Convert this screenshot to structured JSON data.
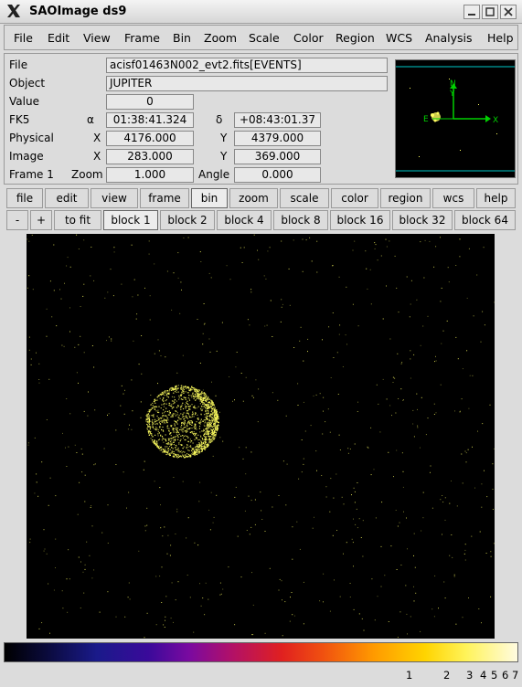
{
  "window": {
    "title": "SAOImage ds9"
  },
  "menu": [
    "File",
    "Edit",
    "View",
    "Frame",
    "Bin",
    "Zoom",
    "Scale",
    "Color",
    "Region",
    "WCS",
    "Analysis",
    "Help"
  ],
  "info": {
    "file_label": "File",
    "file_value": "acisf01463N002_evt2.fits[EVENTS]",
    "object_label": "Object",
    "object_value": "JUPITER",
    "value_label": "Value",
    "value_value": "0",
    "fk5_label": "FK5",
    "alpha_symbol": "α",
    "alpha_value": "01:38:41.324",
    "delta_symbol": "δ",
    "delta_value": "+08:43:01.37",
    "physical_label": "Physical",
    "phys_x_label": "X",
    "phys_x_value": "4176.000",
    "phys_y_label": "Y",
    "phys_y_value": "4379.000",
    "image_label": "Image",
    "img_x_label": "X",
    "img_x_value": "283.000",
    "img_y_label": "Y",
    "img_y_value": "369.000",
    "frame_label": "Frame 1",
    "zoom_label": "Zoom",
    "zoom_value": "1.000",
    "angle_label": "Angle",
    "angle_value": "0.000"
  },
  "panner": {
    "n_label": "N",
    "e_label": "E",
    "x_label": "X",
    "y_label": "Y"
  },
  "buttonbar": [
    "file",
    "edit",
    "view",
    "frame",
    "bin",
    "zoom",
    "scale",
    "color",
    "region",
    "wcs",
    "help"
  ],
  "bin_buttons": [
    "-",
    "+",
    "to fit",
    "block 1",
    "block 2",
    "block 4",
    "block 8",
    "block 16",
    "block 32",
    "block 64"
  ],
  "colorbar_ticks": [
    "1",
    "2",
    "3",
    "4",
    "5",
    "6",
    "7"
  ],
  "colors": {
    "accent": "#00c8c8",
    "source": "#ffff60"
  }
}
